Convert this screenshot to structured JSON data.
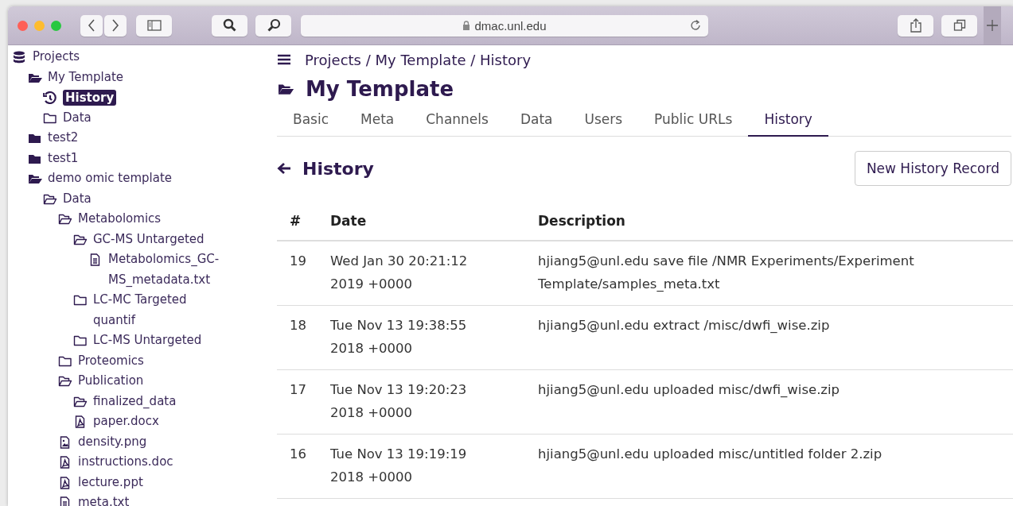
{
  "browser": {
    "url": "dmac.unl.edu"
  },
  "sidebar": {
    "tree": [
      {
        "label": "Projects",
        "kind": "database",
        "selected": false,
        "children": [
          {
            "label": "My Template",
            "kind": "folder-open-solid",
            "selected": false,
            "children": [
              {
                "label": "History",
                "kind": "history",
                "selected": true
              },
              {
                "label": "Data",
                "kind": "folder",
                "selected": false
              }
            ]
          },
          {
            "label": "test2",
            "kind": "folder-solid",
            "selected": false
          },
          {
            "label": "test1",
            "kind": "folder-solid",
            "selected": false
          },
          {
            "label": "demo omic template",
            "kind": "folder-open-solid",
            "selected": false,
            "children": [
              {
                "label": "Data",
                "kind": "folder-open",
                "selected": false,
                "children": [
                  {
                    "label": "Metabolomics",
                    "kind": "folder-open",
                    "selected": false,
                    "children": [
                      {
                        "label": "GC-MS Untargeted",
                        "kind": "folder-open",
                        "selected": false,
                        "children": [
                          {
                            "label": "Metabolomics_GC-MS_metadata.txt",
                            "kind": "file-text",
                            "selected": false
                          }
                        ]
                      },
                      {
                        "label": "LC-MC Targeted quantif",
                        "kind": "folder",
                        "selected": false
                      },
                      {
                        "label": "LC-MS Untargeted",
                        "kind": "folder",
                        "selected": false
                      }
                    ]
                  },
                  {
                    "label": "Proteomics",
                    "kind": "folder",
                    "selected": false
                  },
                  {
                    "label": "Publication",
                    "kind": "folder-open",
                    "selected": false,
                    "children": [
                      {
                        "label": "finalized_data",
                        "kind": "folder-open",
                        "selected": false
                      },
                      {
                        "label": "paper.docx",
                        "kind": "file-pdf",
                        "selected": false
                      }
                    ]
                  },
                  {
                    "label": "density.png",
                    "kind": "file-image",
                    "selected": false
                  },
                  {
                    "label": "instructions.doc",
                    "kind": "file-pdf",
                    "selected": false
                  },
                  {
                    "label": "lecture.ppt",
                    "kind": "file-pdf",
                    "selected": false
                  },
                  {
                    "label": "meta.txt",
                    "kind": "file-text",
                    "selected": false
                  }
                ]
              }
            ]
          }
        ]
      }
    ]
  },
  "breadcrumb": "Projects / My Template / History",
  "project_title": "My Template",
  "tabs": [
    {
      "label": "Basic",
      "selected": false
    },
    {
      "label": "Meta",
      "selected": false
    },
    {
      "label": "Channels",
      "selected": false
    },
    {
      "label": "Data",
      "selected": false
    },
    {
      "label": "Users",
      "selected": false
    },
    {
      "label": "Public URLs",
      "selected": false
    },
    {
      "label": "History",
      "selected": true
    }
  ],
  "section_title": "History",
  "new_button": "New History Record",
  "table": {
    "columns": [
      "#",
      "Date",
      "Description"
    ],
    "rows": [
      [
        "19",
        "Wed Jan 30 20:21:12 2019 +0000",
        "hjiang5@unl.edu save file /NMR Experiments/Experiment Template/samples_meta.txt"
      ],
      [
        "18",
        "Tue Nov 13 19:38:55 2018 +0000",
        "hjiang5@unl.edu extract /misc/dwfi_wise.zip"
      ],
      [
        "17",
        "Tue Nov 13 19:20:23 2018 +0000",
        "hjiang5@unl.edu uploaded misc/dwfi_wise.zip"
      ],
      [
        "16",
        "Tue Nov 13 19:19:19 2018 +0000",
        "hjiang5@unl.edu uploaded misc/untitled folder 2.zip"
      ]
    ]
  }
}
